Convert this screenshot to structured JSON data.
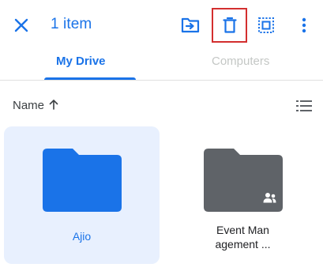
{
  "header": {
    "title": "1 item",
    "icons": [
      "close-icon",
      "move-to-folder-icon",
      "trash-icon",
      "select-all-icon",
      "more-vert-icon"
    ]
  },
  "tabs": [
    {
      "label": "My Drive",
      "active": true
    },
    {
      "label": "Computers",
      "active": false
    }
  ],
  "sort": {
    "label": "Name",
    "direction": "ascending"
  },
  "files": [
    {
      "name": "Ajio",
      "type": "folder",
      "selected": true,
      "shared": false,
      "color": "#1a73e8"
    },
    {
      "name": "Event Man\nagement ...",
      "type": "folder",
      "selected": false,
      "shared": true,
      "color": "#5f6368"
    }
  ],
  "colors": {
    "accent": "#1a73e8",
    "highlight_box": "#d32f2f",
    "selected_bg": "#e8f0fe"
  }
}
